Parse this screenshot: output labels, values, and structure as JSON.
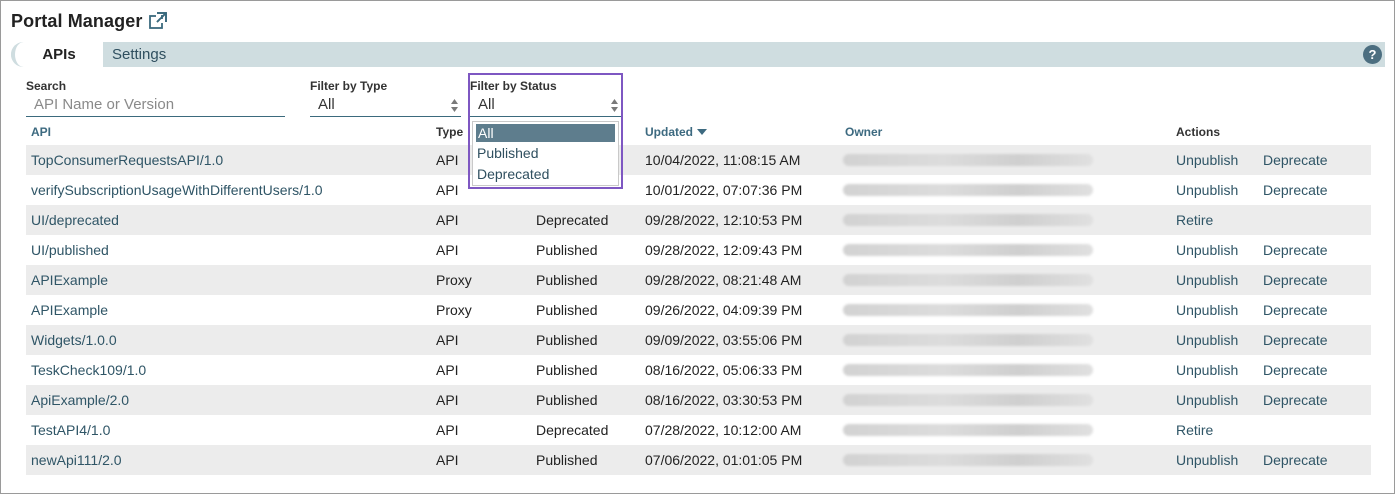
{
  "header": {
    "title": "Portal Manager",
    "external_icon": "external-link-icon"
  },
  "tabs": {
    "apis": "APIs",
    "settings": "Settings",
    "help": "?"
  },
  "filters": {
    "search_label": "Search",
    "search_placeholder": "API Name or Version",
    "type_label": "Filter by Type",
    "type_value": "All",
    "status_label": "Filter by Status",
    "status_value": "All",
    "status_options": [
      "All",
      "Published",
      "Deprecated"
    ]
  },
  "table": {
    "headers": {
      "api": "API",
      "type": "Type",
      "updated": "Updated",
      "owner": "Owner",
      "actions": "Actions"
    },
    "rows": [
      {
        "api": "TopConsumerRequestsAPI/1.0",
        "type": "API",
        "status": "",
        "updated": "10/04/2022, 11:08:15 AM",
        "actions": [
          "Unpublish",
          "Deprecate"
        ]
      },
      {
        "api": "verifySubscriptionUsageWithDifferentUsers/1.0",
        "type": "API",
        "status": "",
        "updated": "10/01/2022, 07:07:36 PM",
        "actions": [
          "Unpublish",
          "Deprecate"
        ]
      },
      {
        "api": "UI/deprecated",
        "type": "API",
        "status": "Deprecated",
        "updated": "09/28/2022, 12:10:53 PM",
        "actions": [
          "Retire"
        ]
      },
      {
        "api": "UI/published",
        "type": "API",
        "status": "Published",
        "updated": "09/28/2022, 12:09:43 PM",
        "actions": [
          "Unpublish",
          "Deprecate"
        ]
      },
      {
        "api": "APIExample",
        "type": "Proxy",
        "status": "Published",
        "updated": "09/28/2022, 08:21:48 AM",
        "actions": [
          "Unpublish",
          "Deprecate"
        ]
      },
      {
        "api": "APIExample",
        "type": "Proxy",
        "status": "Published",
        "updated": "09/26/2022, 04:09:39 PM",
        "actions": [
          "Unpublish",
          "Deprecate"
        ]
      },
      {
        "api": "Widgets/1.0.0",
        "type": "API",
        "status": "Published",
        "updated": "09/09/2022, 03:55:06 PM",
        "actions": [
          "Unpublish",
          "Deprecate"
        ]
      },
      {
        "api": "TeskCheck109/1.0",
        "type": "API",
        "status": "Published",
        "updated": "08/16/2022, 05:06:33 PM",
        "actions": [
          "Unpublish",
          "Deprecate"
        ]
      },
      {
        "api": "ApiExample/2.0",
        "type": "API",
        "status": "Published",
        "updated": "08/16/2022, 03:30:53 PM",
        "actions": [
          "Unpublish",
          "Deprecate"
        ]
      },
      {
        "api": "TestAPI4/1.0",
        "type": "API",
        "status": "Deprecated",
        "updated": "07/28/2022, 10:12:00 AM",
        "actions": [
          "Retire"
        ]
      },
      {
        "api": "newApi111/2.0",
        "type": "API",
        "status": "Published",
        "updated": "07/06/2022, 01:01:05 PM",
        "actions": [
          "Unpublish",
          "Deprecate"
        ]
      }
    ]
  },
  "colors": {
    "accent": "#3d6a80",
    "tab_bar": "#cfdde0",
    "highlight": "#7e57c2",
    "selected_option": "#5e7d8d"
  }
}
